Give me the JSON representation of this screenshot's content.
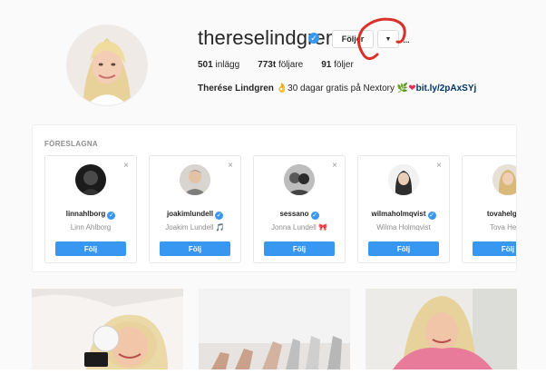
{
  "profile": {
    "username": "thereselindgren",
    "follow_label": "Följer",
    "dropdown_glyph": "▼",
    "more_glyph": "...",
    "stats": {
      "posts_value": "501",
      "posts_label": "inlägg",
      "followers_value": "773t",
      "followers_label": "följare",
      "following_value": "91",
      "following_label": "följer"
    },
    "bio": {
      "name": "Therése Lindgren",
      "emoji_lead": "👌",
      "text": "30 dagar gratis på Nextory",
      "emoji_trail_1": "🌿",
      "emoji_trail_2": "❤",
      "link": "bit.ly/2pAxSYj"
    }
  },
  "suggested": {
    "title": "FÖRESLAGNA",
    "close_glyph": "×",
    "cards": [
      {
        "username": "linnahlborg",
        "name": "Linn Ahlborg",
        "button": "Följ"
      },
      {
        "username": "joakimlundell",
        "name": "Joakim Lundell 🎵",
        "button": "Följ"
      },
      {
        "username": "sessano",
        "name": "Jonna Lundell 🎀",
        "button": "Följ"
      },
      {
        "username": "wilmaholmqvist",
        "name": "Wilma Holmqvist",
        "button": "Följ"
      },
      {
        "username": "tovahelgess",
        "name": "Tova Helge",
        "button": "Följ"
      }
    ]
  },
  "colors": {
    "accent": "#3897f0",
    "annotation": "#d9302a"
  },
  "icons": [
    "verified-badge-icon",
    "chevron-down-icon",
    "more-icon",
    "close-icon"
  ]
}
